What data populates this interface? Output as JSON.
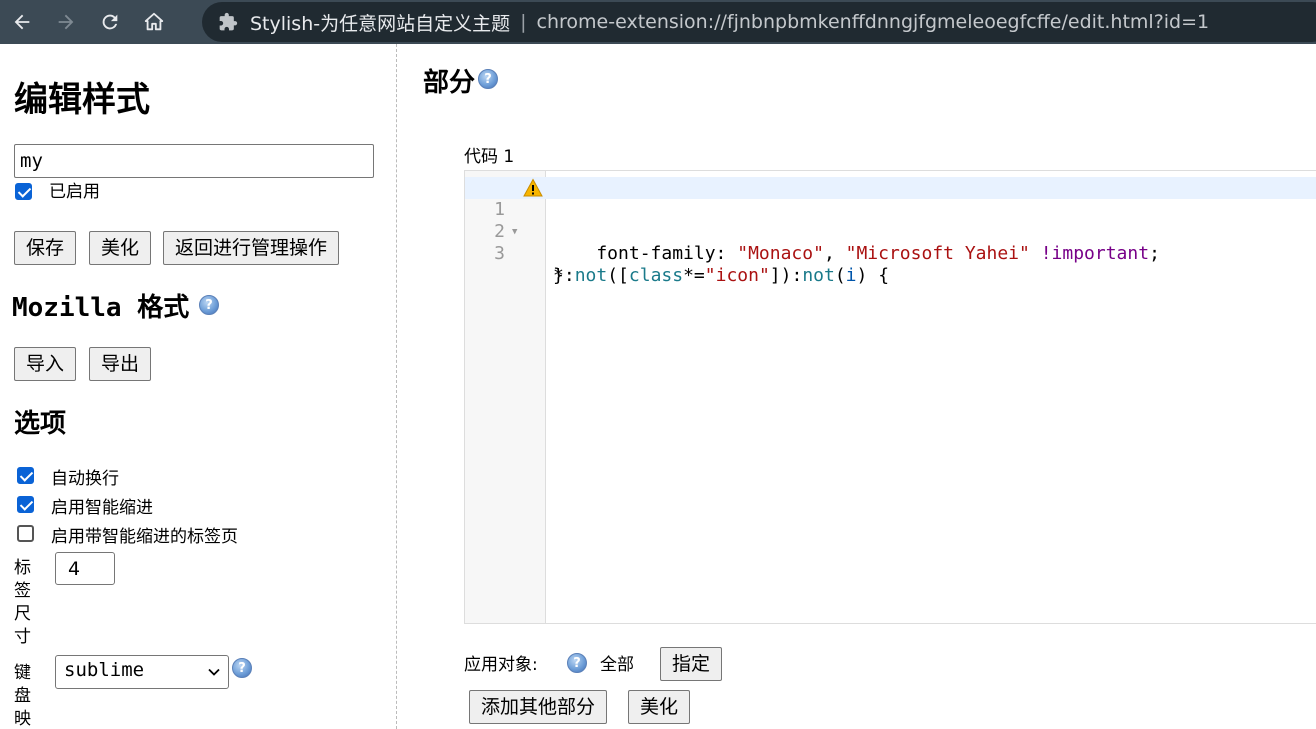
{
  "browser": {
    "site_name": "Stylish-为任意网站自定义主题",
    "separator": "|",
    "url": "chrome-extension://fjnbnpbmkenffdnngjfgmeleoegfcffe/edit.html?id=1"
  },
  "sidebar": {
    "title": "编辑样式",
    "style_name_value": "my",
    "enabled_label": "已启用",
    "enabled_checked": true,
    "buttons": {
      "save": "保存",
      "beautify": "美化",
      "back": "返回进行管理操作"
    },
    "mozilla_title": "Mozilla 格式",
    "import_label": "导入",
    "export_label": "导出",
    "options_title": "选项",
    "options": [
      {
        "label": "自动换行",
        "checked": true
      },
      {
        "label": "启用智能缩进",
        "checked": true
      },
      {
        "label": "启用带智能缩进的标签页",
        "checked": false
      }
    ],
    "tab_size_label": "标签尺寸",
    "tab_size_value": "4",
    "keymap_label": "键盘映",
    "keymap_value": "sublime"
  },
  "main": {
    "section_title": "部分",
    "code_label": "代码 1",
    "code_lines": [
      {
        "num": "1"
      },
      {
        "num": "2"
      },
      {
        "num": "3"
      }
    ],
    "code": {
      "l1_a": "*:",
      "l1_b": "not",
      "l1_c": "([",
      "l1_d": "class",
      "l1_e": "*=",
      "l1_f": "\"icon\"",
      "l1_g": "]):",
      "l1_h": "not",
      "l1_i": "(",
      "l1_j": "i",
      "l1_k": ") {",
      "l2_a": "    font-family: ",
      "l2_b": "\"Monaco\"",
      "l2_c": ", ",
      "l2_d": "\"Microsoft Yahei\"",
      "l2_e": " ",
      "l2_f": "!important",
      "l2_g": ";",
      "l3_a": "}"
    },
    "apply_label": "应用对象:",
    "apply_all": "全部",
    "specify_label": "指定",
    "add_section_label": "添加其他部分",
    "beautify_label": "美化"
  },
  "colors": {
    "browser_bar": "#3c4a55",
    "omnibox": "#202a31",
    "checkbox_accent": "#0a63d6"
  }
}
